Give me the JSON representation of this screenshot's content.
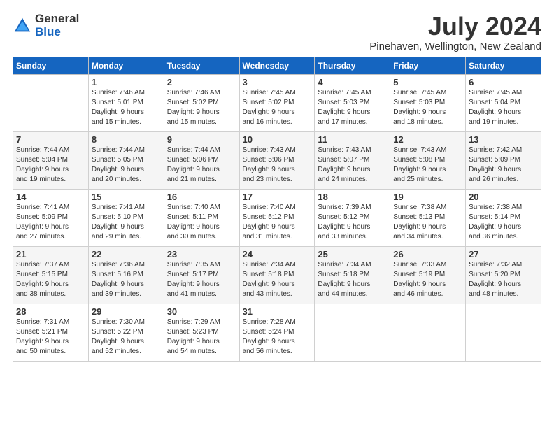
{
  "logo": {
    "general": "General",
    "blue": "Blue"
  },
  "title": "July 2024",
  "subtitle": "Pinehaven, Wellington, New Zealand",
  "days_of_week": [
    "Sunday",
    "Monday",
    "Tuesday",
    "Wednesday",
    "Thursday",
    "Friday",
    "Saturday"
  ],
  "weeks": [
    [
      {
        "day": "",
        "info": ""
      },
      {
        "day": "1",
        "info": "Sunrise: 7:46 AM\nSunset: 5:01 PM\nDaylight: 9 hours\nand 15 minutes."
      },
      {
        "day": "2",
        "info": "Sunrise: 7:46 AM\nSunset: 5:02 PM\nDaylight: 9 hours\nand 15 minutes."
      },
      {
        "day": "3",
        "info": "Sunrise: 7:45 AM\nSunset: 5:02 PM\nDaylight: 9 hours\nand 16 minutes."
      },
      {
        "day": "4",
        "info": "Sunrise: 7:45 AM\nSunset: 5:03 PM\nDaylight: 9 hours\nand 17 minutes."
      },
      {
        "day": "5",
        "info": "Sunrise: 7:45 AM\nSunset: 5:03 PM\nDaylight: 9 hours\nand 18 minutes."
      },
      {
        "day": "6",
        "info": "Sunrise: 7:45 AM\nSunset: 5:04 PM\nDaylight: 9 hours\nand 19 minutes."
      }
    ],
    [
      {
        "day": "7",
        "info": "Sunrise: 7:44 AM\nSunset: 5:04 PM\nDaylight: 9 hours\nand 19 minutes."
      },
      {
        "day": "8",
        "info": "Sunrise: 7:44 AM\nSunset: 5:05 PM\nDaylight: 9 hours\nand 20 minutes."
      },
      {
        "day": "9",
        "info": "Sunrise: 7:44 AM\nSunset: 5:06 PM\nDaylight: 9 hours\nand 21 minutes."
      },
      {
        "day": "10",
        "info": "Sunrise: 7:43 AM\nSunset: 5:06 PM\nDaylight: 9 hours\nand 23 minutes."
      },
      {
        "day": "11",
        "info": "Sunrise: 7:43 AM\nSunset: 5:07 PM\nDaylight: 9 hours\nand 24 minutes."
      },
      {
        "day": "12",
        "info": "Sunrise: 7:43 AM\nSunset: 5:08 PM\nDaylight: 9 hours\nand 25 minutes."
      },
      {
        "day": "13",
        "info": "Sunrise: 7:42 AM\nSunset: 5:09 PM\nDaylight: 9 hours\nand 26 minutes."
      }
    ],
    [
      {
        "day": "14",
        "info": "Sunrise: 7:41 AM\nSunset: 5:09 PM\nDaylight: 9 hours\nand 27 minutes."
      },
      {
        "day": "15",
        "info": "Sunrise: 7:41 AM\nSunset: 5:10 PM\nDaylight: 9 hours\nand 29 minutes."
      },
      {
        "day": "16",
        "info": "Sunrise: 7:40 AM\nSunset: 5:11 PM\nDaylight: 9 hours\nand 30 minutes."
      },
      {
        "day": "17",
        "info": "Sunrise: 7:40 AM\nSunset: 5:12 PM\nDaylight: 9 hours\nand 31 minutes."
      },
      {
        "day": "18",
        "info": "Sunrise: 7:39 AM\nSunset: 5:12 PM\nDaylight: 9 hours\nand 33 minutes."
      },
      {
        "day": "19",
        "info": "Sunrise: 7:38 AM\nSunset: 5:13 PM\nDaylight: 9 hours\nand 34 minutes."
      },
      {
        "day": "20",
        "info": "Sunrise: 7:38 AM\nSunset: 5:14 PM\nDaylight: 9 hours\nand 36 minutes."
      }
    ],
    [
      {
        "day": "21",
        "info": "Sunrise: 7:37 AM\nSunset: 5:15 PM\nDaylight: 9 hours\nand 38 minutes."
      },
      {
        "day": "22",
        "info": "Sunrise: 7:36 AM\nSunset: 5:16 PM\nDaylight: 9 hours\nand 39 minutes."
      },
      {
        "day": "23",
        "info": "Sunrise: 7:35 AM\nSunset: 5:17 PM\nDaylight: 9 hours\nand 41 minutes."
      },
      {
        "day": "24",
        "info": "Sunrise: 7:34 AM\nSunset: 5:18 PM\nDaylight: 9 hours\nand 43 minutes."
      },
      {
        "day": "25",
        "info": "Sunrise: 7:34 AM\nSunset: 5:18 PM\nDaylight: 9 hours\nand 44 minutes."
      },
      {
        "day": "26",
        "info": "Sunrise: 7:33 AM\nSunset: 5:19 PM\nDaylight: 9 hours\nand 46 minutes."
      },
      {
        "day": "27",
        "info": "Sunrise: 7:32 AM\nSunset: 5:20 PM\nDaylight: 9 hours\nand 48 minutes."
      }
    ],
    [
      {
        "day": "28",
        "info": "Sunrise: 7:31 AM\nSunset: 5:21 PM\nDaylight: 9 hours\nand 50 minutes."
      },
      {
        "day": "29",
        "info": "Sunrise: 7:30 AM\nSunset: 5:22 PM\nDaylight: 9 hours\nand 52 minutes."
      },
      {
        "day": "30",
        "info": "Sunrise: 7:29 AM\nSunset: 5:23 PM\nDaylight: 9 hours\nand 54 minutes."
      },
      {
        "day": "31",
        "info": "Sunrise: 7:28 AM\nSunset: 5:24 PM\nDaylight: 9 hours\nand 56 minutes."
      },
      {
        "day": "",
        "info": ""
      },
      {
        "day": "",
        "info": ""
      },
      {
        "day": "",
        "info": ""
      }
    ]
  ]
}
